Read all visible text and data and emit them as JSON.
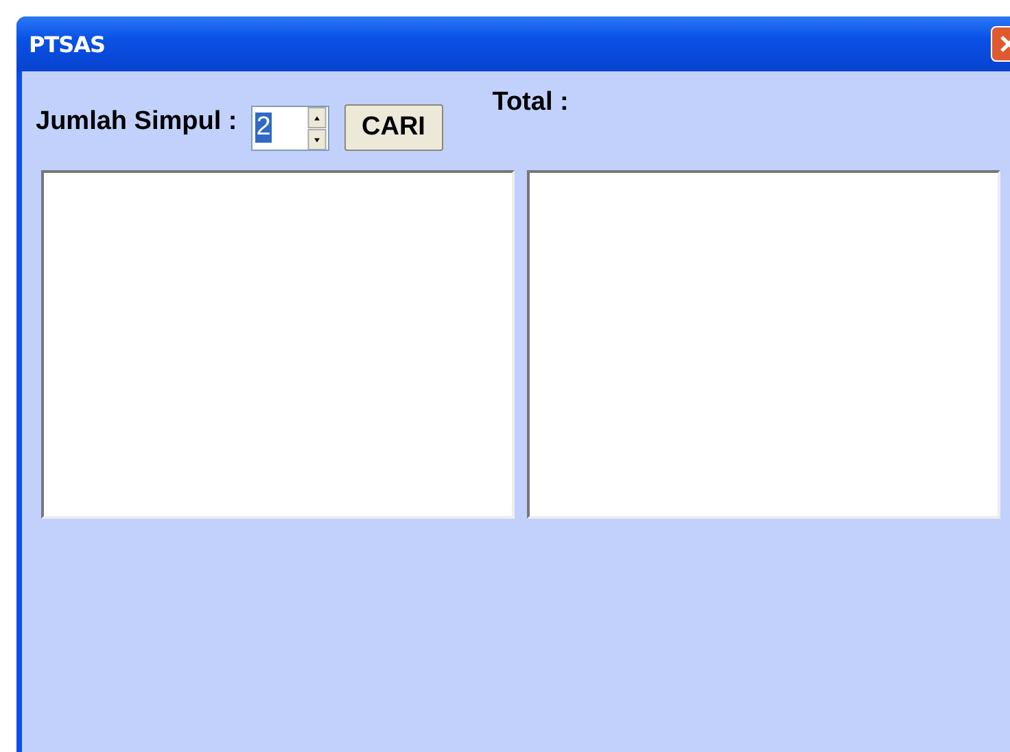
{
  "window": {
    "title": "PTSAS"
  },
  "spinner": {
    "label": "Jumlah Simpul :",
    "value": "2",
    "text_selected": true
  },
  "search_button": "CARI",
  "total_label": "Total :",
  "lists": [
    {
      "kind": "listbox"
    },
    {
      "kind": "listbox"
    }
  ]
}
